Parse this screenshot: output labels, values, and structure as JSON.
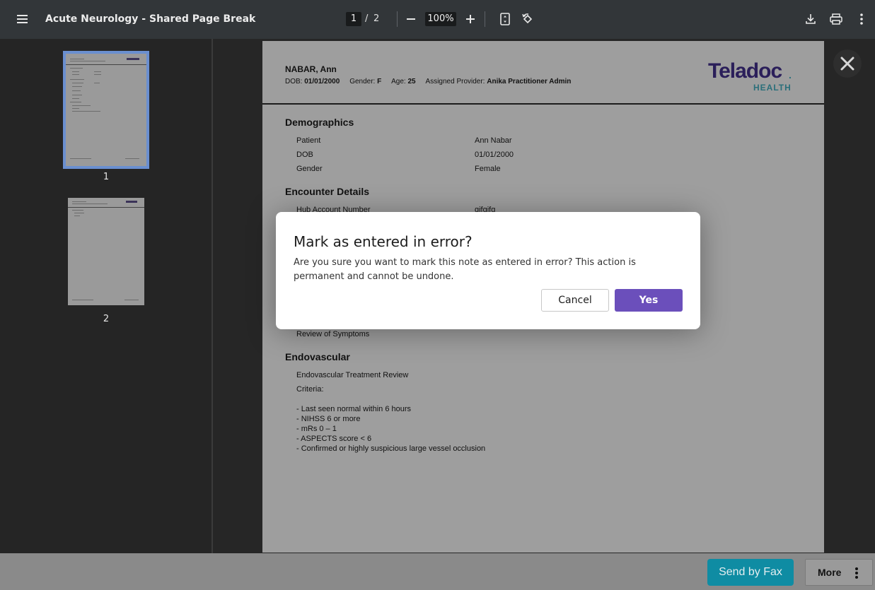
{
  "toolbar": {
    "title": "Acute Neurology - Shared Page Break",
    "current_page": "1",
    "page_separator": "/",
    "total_pages": "2",
    "zoom": "100%",
    "icons": [
      "menu-icon",
      "zoom-out-icon",
      "zoom-in-icon",
      "fit-page-icon",
      "rotate-icon",
      "download-icon",
      "print-icon",
      "more-vert-icon"
    ]
  },
  "sidebar": {
    "thumbnails": [
      {
        "label": "1",
        "active": true
      },
      {
        "label": "2",
        "active": false
      }
    ]
  },
  "document": {
    "patient_name": "NABAR, Ann",
    "meta": {
      "dob_label": "DOB:",
      "dob": "01/01/2000",
      "gender_label": "Gender:",
      "gender": "F",
      "age_label": "Age:",
      "age": "25",
      "provider_label": "Assigned Provider:",
      "provider": "Anika Practitioner Admin"
    },
    "logo": {
      "main": "Teladoc",
      "sub": "HEALTH",
      "mark": "."
    },
    "sections": {
      "demographics": {
        "title": "Demographics",
        "rows": [
          {
            "label": "Patient",
            "value": "Ann Nabar"
          },
          {
            "label": "DOB",
            "value": "01/01/2000"
          },
          {
            "label": "Gender",
            "value": "Female"
          }
        ]
      },
      "encounter": {
        "title": "Encounter Details",
        "rows": [
          {
            "label": "Hub Account Number",
            "value": "gjfgjfg"
          }
        ]
      },
      "review_of_symptoms": "Review of Symptoms",
      "endovascular": {
        "title": "Endovascular",
        "treatment_review": "Endovascular Treatment Review",
        "criteria_label": "Criteria:",
        "criteria": [
          "- Last seen normal within 6 hours",
          "- NIHSS 6 or more",
          "- mRs 0 – 1",
          "- ASPECTS score < 6",
          "- Confirmed or highly suspicious large vessel occlusion"
        ]
      }
    }
  },
  "bottom_bar": {
    "send_fax_label": "Send by Fax",
    "more_label": "More"
  },
  "dialog": {
    "title": "Mark as entered in error?",
    "body": "Are you sure you want to mark this note as entered in error? This action is permanent and cannot be undone.",
    "cancel_label": "Cancel",
    "confirm_label": "Yes"
  },
  "colors": {
    "toolbar_bg": "#323639",
    "accent_purple": "#6b4fbb",
    "fax_teal": "#0f8ca3",
    "logo_navy": "#2b1f5a",
    "logo_teal": "#2a6f7a"
  }
}
